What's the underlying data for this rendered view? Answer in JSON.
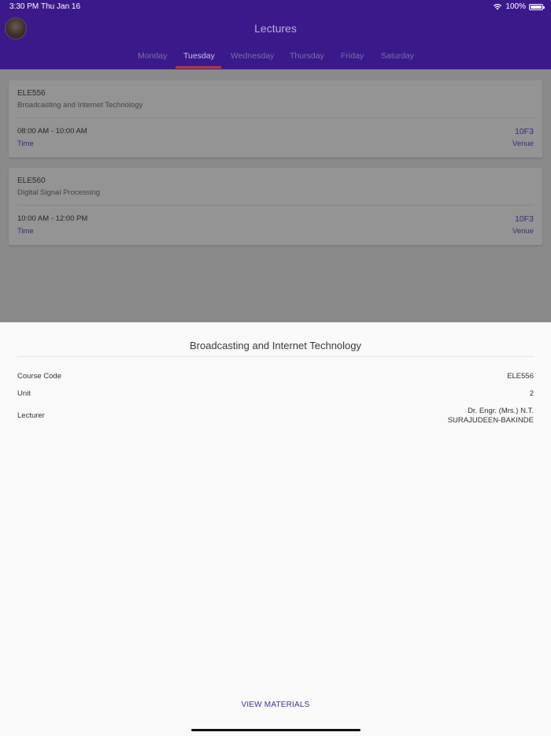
{
  "status": {
    "time": "3:30 PM",
    "date": "Thu Jan 16",
    "battery": "100%"
  },
  "header": {
    "title": "Lectures"
  },
  "tabs": [
    {
      "label": "Monday",
      "active": false
    },
    {
      "label": "Tuesday",
      "active": true
    },
    {
      "label": "Wednesday",
      "active": false
    },
    {
      "label": "Thursday",
      "active": false
    },
    {
      "label": "Friday",
      "active": false
    },
    {
      "label": "Saturday",
      "active": false
    }
  ],
  "lectures": [
    {
      "code": "ELE556",
      "name": "Broadcasting and Internet Technology",
      "time": "08:00 AM - 10:00 AM",
      "time_label": "Time",
      "venue": "10F3",
      "venue_label": "Venue"
    },
    {
      "code": "ELE560",
      "name": "Digital Signal Processing",
      "time": "10:00 AM - 12:00 PM",
      "time_label": "Time",
      "venue": "10F3",
      "venue_label": "Venue"
    }
  ],
  "sheet": {
    "title": "Broadcasting and Internet Technology",
    "course_code_label": "Course Code",
    "course_code": "ELE556",
    "unit_label": "Unit",
    "unit": "2",
    "lecturer_label": "Lecturer",
    "lecturer_line1": "Dr. Engr. (Mrs.) N.T.",
    "lecturer_line2": "SURAJUDEEN-BAKINDE",
    "action": "VIEW MATERIALS"
  },
  "colors": {
    "header": "#3a1a8a",
    "accent": "#4b2ea0",
    "tab_indicator": "#c0392b",
    "sheet_bg": "#fafafa"
  }
}
